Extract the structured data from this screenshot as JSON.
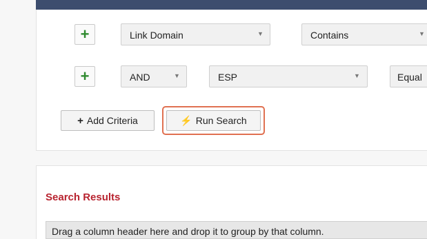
{
  "criteria": {
    "row1": {
      "add_icon": "plus-icon",
      "field": "Link Domain",
      "operator": "Contains"
    },
    "row2": {
      "add_icon": "plus-icon",
      "logic": "AND",
      "field": "ESP",
      "operator": "Equal"
    },
    "add_criteria_label": "Add Criteria",
    "run_search_label": "Run Search"
  },
  "results": {
    "title": "Search Results",
    "group_hint": "Drag a column header here and drop it to group by that column."
  },
  "colors": {
    "header": "#3d4d6e",
    "plus_green": "#2f8a2f",
    "results_title_red": "#b8232f",
    "highlight_orange": "#e07050"
  }
}
